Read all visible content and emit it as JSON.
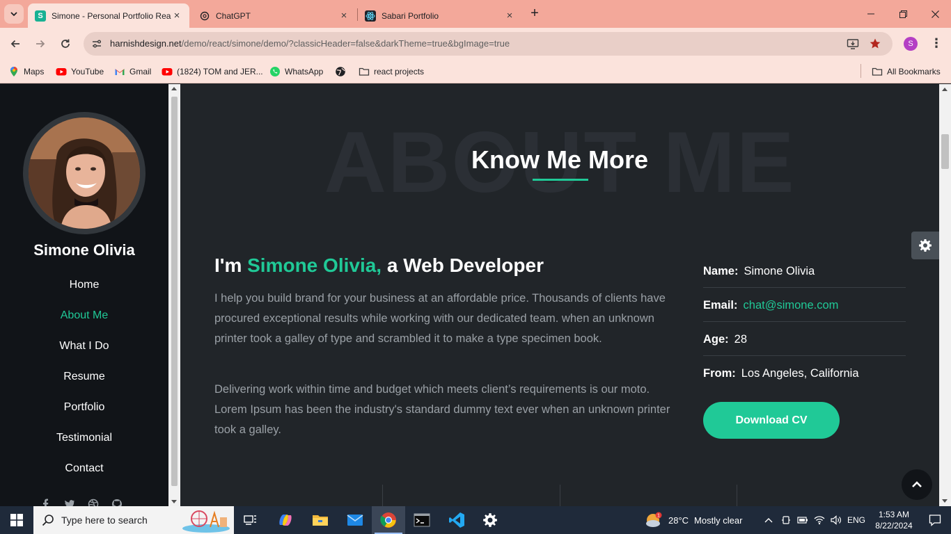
{
  "browser": {
    "tabs": [
      {
        "title": "Simone - Personal Portfolio Rea",
        "active": true
      },
      {
        "title": "ChatGPT",
        "active": false
      },
      {
        "title": "Sabari Portfolio",
        "active": false
      }
    ],
    "favicon_letter": "S",
    "url_domain": "harnishdesign.net",
    "url_path": "/demo/react/simone/demo/?classicHeader=false&darkTheme=true&bgImage=true",
    "profile_initial": "S",
    "bookmarks": [
      "Maps",
      "YouTube",
      "Gmail",
      "(1824) TOM and JER...",
      "WhatsApp",
      "react projects"
    ],
    "all_bookmarks": "All Bookmarks"
  },
  "sidebar": {
    "name": "Simone Olivia",
    "nav": [
      "Home",
      "About Me",
      "What I Do",
      "Resume",
      "Portfolio",
      "Testimonial",
      "Contact"
    ],
    "active_index": 1
  },
  "about": {
    "bg_title": "ABOUT ME",
    "title": "Know Me More",
    "intro_prefix": "I'm ",
    "intro_name": "Simone Olivia,",
    "intro_suffix": " a Web Developer",
    "para1": "I help you build brand for your business at an affordable price. Thousands of clients have procured exceptional results while working with our dedicated team. when an unknown printer took a galley of type and scrambled it to make a type specimen book.",
    "para2": "Delivering work within time and budget which meets client’s requirements is our moto. Lorem Ipsum has been the industry's standard dummy text ever when an unknown printer took a galley.",
    "info": [
      {
        "key": "Name:",
        "value": "Simone Olivia"
      },
      {
        "key": "Email:",
        "value": "chat@simone.com"
      },
      {
        "key": "Age:",
        "value": "28"
      },
      {
        "key": "From:",
        "value": "Los Angeles, California"
      }
    ],
    "cv_button": "Download CV"
  },
  "taskbar": {
    "search_placeholder": "Type here to search",
    "weather_temp": "28°C",
    "weather_text": "Mostly clear",
    "lang": "ENG",
    "time": "1:53 AM",
    "date": "8/22/2024"
  },
  "colors": {
    "accent": "#20c997",
    "sidebar_bg": "#111418",
    "page_bg": "#212529",
    "tab_strip": "#f3a89a",
    "toolbar": "#fbe3dc"
  }
}
